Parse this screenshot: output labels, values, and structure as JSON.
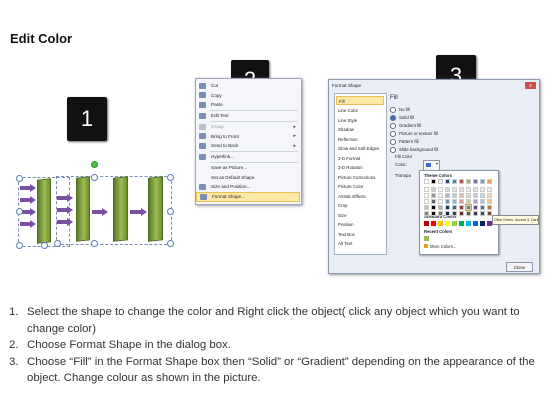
{
  "title": "Edit Color",
  "steps": [
    "1",
    "2",
    "3"
  ],
  "context_menu": {
    "items": [
      {
        "label": "Cut",
        "state": "normal"
      },
      {
        "label": "Copy",
        "state": "normal"
      },
      {
        "label": "Paste",
        "state": "normal"
      },
      {
        "label": "Edit Text",
        "state": "normal"
      },
      {
        "label": "Group",
        "state": "disabled",
        "submenu": true
      },
      {
        "label": "Bring to Front",
        "state": "normal",
        "submenu": true
      },
      {
        "label": "Send to Back",
        "state": "normal",
        "submenu": true
      },
      {
        "label": "Hyperlink...",
        "state": "normal"
      },
      {
        "label": "Save as Picture...",
        "state": "normal"
      },
      {
        "label": "Set as Default Shape",
        "state": "normal"
      },
      {
        "label": "Size and Position...",
        "state": "normal"
      },
      {
        "label": "Format Shape...",
        "state": "highlighted"
      }
    ]
  },
  "dialog": {
    "title": "Format Shape",
    "close_x": "x",
    "categories": [
      "Fill",
      "Line Color",
      "Line Style",
      "Shadow",
      "Reflection",
      "Glow and Soft Edges",
      "3-D Format",
      "3-D Rotation",
      "Picture Corrections",
      "Picture Color",
      "Artistic Effects",
      "Crop",
      "Size",
      "Position",
      "Text Box",
      "Alt Text"
    ],
    "selected_category": "Fill",
    "fill_heading": "Fill",
    "fill_options": [
      {
        "label": "No fill",
        "selected": false
      },
      {
        "label": "Solid fill",
        "selected": true
      },
      {
        "label": "Gradient fill",
        "selected": false
      },
      {
        "label": "Picture or texture fill",
        "selected": false
      },
      {
        "label": "Pattern fill",
        "selected": false
      },
      {
        "label": "Slide background fill",
        "selected": false
      }
    ],
    "fill_color_heading": "Fill Color",
    "color_label": "Color:",
    "transparency_label": "Transpa",
    "picker": {
      "theme_colors_label": "Theme Colors",
      "standard_colors_label": "Standard Colors",
      "recent_colors_label": "Recent Colors",
      "more_colors_label": "More Colors...",
      "theme_colors": [
        "#ffffff",
        "#000000",
        "#eeece1",
        "#1f497d",
        "#4f81bd",
        "#c0504d",
        "#9bbb59",
        "#8064a2",
        "#4bacc6",
        "#f79646"
      ],
      "standard_colors": [
        "#c00000",
        "#ff0000",
        "#ffc000",
        "#ffff00",
        "#92d050",
        "#00b050",
        "#00b0f0",
        "#0070c0",
        "#002060",
        "#7030a0"
      ],
      "recent_colors": [
        "#9bbb59"
      ]
    },
    "tooltip": "Olive Green, Accent 3, Darker 25%",
    "close_button": "Close"
  },
  "instructions": [
    {
      "num": "1.",
      "text": "Select the shape to change the color and Right click the object( click any object which you want to change color)"
    },
    {
      "num": "2.",
      "text": "Choose Format Shape in the dialog box."
    },
    {
      "num": "3.",
      "text": "Choose “Fill” in the Format Shape box then “Solid” or “Gradient” depending on the appearance of the object. Change colour as shown in the picture."
    }
  ]
}
